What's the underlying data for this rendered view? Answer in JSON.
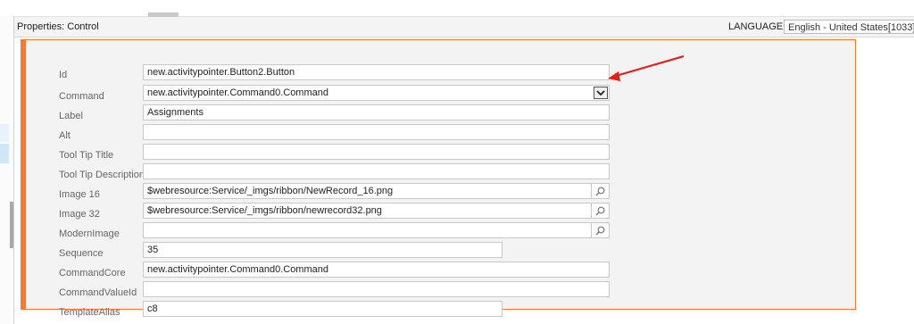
{
  "header": {
    "title": "Properties: Control",
    "language_label": "LANGUAGE:",
    "language_value": "English - United States[1033]"
  },
  "fields": {
    "id": {
      "label": "Id",
      "value": "new.activitypointer.Button2.Button"
    },
    "command": {
      "label": "Command",
      "value": "new.activitypointer.Command0.Command"
    },
    "label": {
      "label": "Label",
      "value": "Assignments"
    },
    "alt": {
      "label": "Alt",
      "value": ""
    },
    "tooltip_title": {
      "label": "Tool Tip Title",
      "value": ""
    },
    "tooltip_description": {
      "label": "Tool Tip Description",
      "value": ""
    },
    "image16": {
      "label": "Image 16",
      "value": "$webresource:Service/_imgs/ribbon/NewRecord_16.png"
    },
    "image32": {
      "label": "Image 32",
      "value": "$webresource:Service/_imgs/ribbon/newrecord32.png"
    },
    "modern_image": {
      "label": "ModernImage",
      "value": ""
    },
    "sequence": {
      "label": "Sequence",
      "value": "35"
    },
    "command_core": {
      "label": "CommandCore",
      "value": "new.activitypointer.Command0.Command"
    },
    "command_value_id": {
      "label": "CommandValueId",
      "value": ""
    },
    "template_alias": {
      "label": "TemplateAlias",
      "value": "c8"
    }
  },
  "icons": {
    "search": "search-icon",
    "dropdown": "chevron-down-icon",
    "annotation": "red-arrow-annotation"
  },
  "colors": {
    "accent_border": "#f07a3a",
    "annotation_arrow": "#e0201e",
    "form_background": "#f3f3f3"
  }
}
